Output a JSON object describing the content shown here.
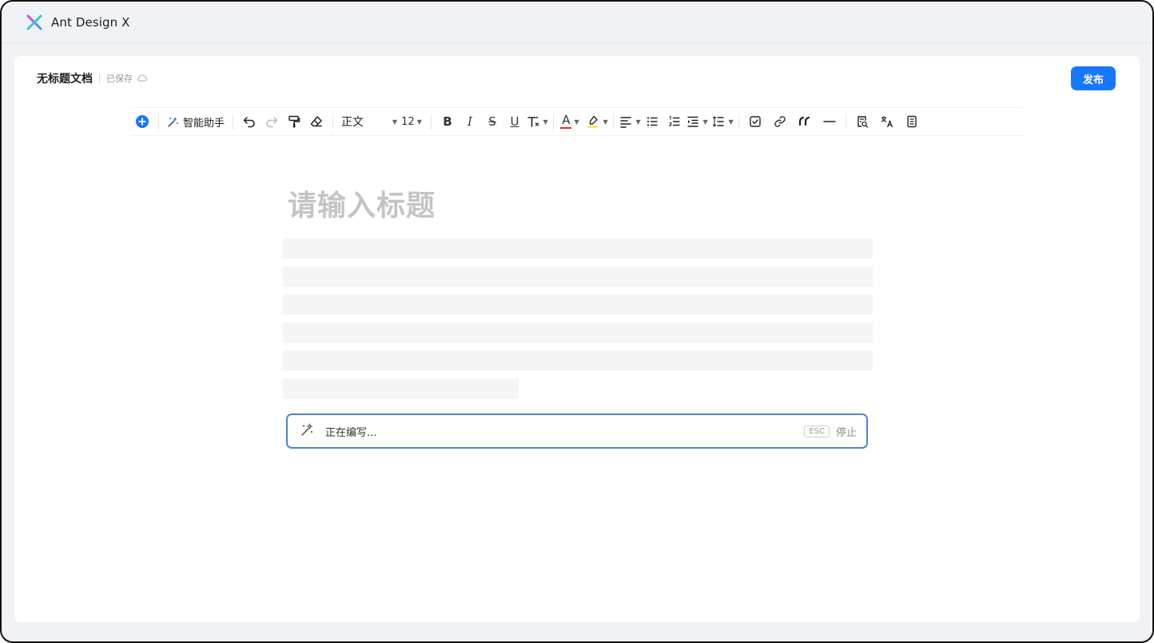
{
  "app": {
    "title": "Ant Design X"
  },
  "document": {
    "title": "无标题文档",
    "save_status": "已保存",
    "publish_label": "发布",
    "title_placeholder": "请输入标题"
  },
  "toolbar": {
    "assistant_label": "智能助手",
    "paragraph_style": "正文",
    "font_size": "12",
    "bold_label": "B",
    "italic_label": "I",
    "strike_label": "S",
    "underline_label": "U",
    "font_color_label": "A",
    "accent": "#1677ff",
    "font_color_underline": "#f5222d",
    "highlight_underline": "#fadb14"
  },
  "ai_writing": {
    "status": "正在编写...",
    "esc_label": "ESC",
    "stop_label": "停止",
    "border_color": "#4a87cc"
  },
  "icons": [
    "logo-x-icon",
    "plus-circle-icon",
    "magic-wand-icon",
    "undo-icon",
    "redo-icon",
    "format-painter-icon",
    "eraser-icon",
    "clear-format-icon",
    "highlighter-icon",
    "align-left-icon",
    "bullet-list-icon",
    "numbered-list-icon",
    "indent-icon",
    "line-height-icon",
    "checkbox-icon",
    "link-icon",
    "quote-icon",
    "divider-icon",
    "search-doc-icon",
    "translate-icon",
    "notes-icon",
    "cloud-icon"
  ]
}
